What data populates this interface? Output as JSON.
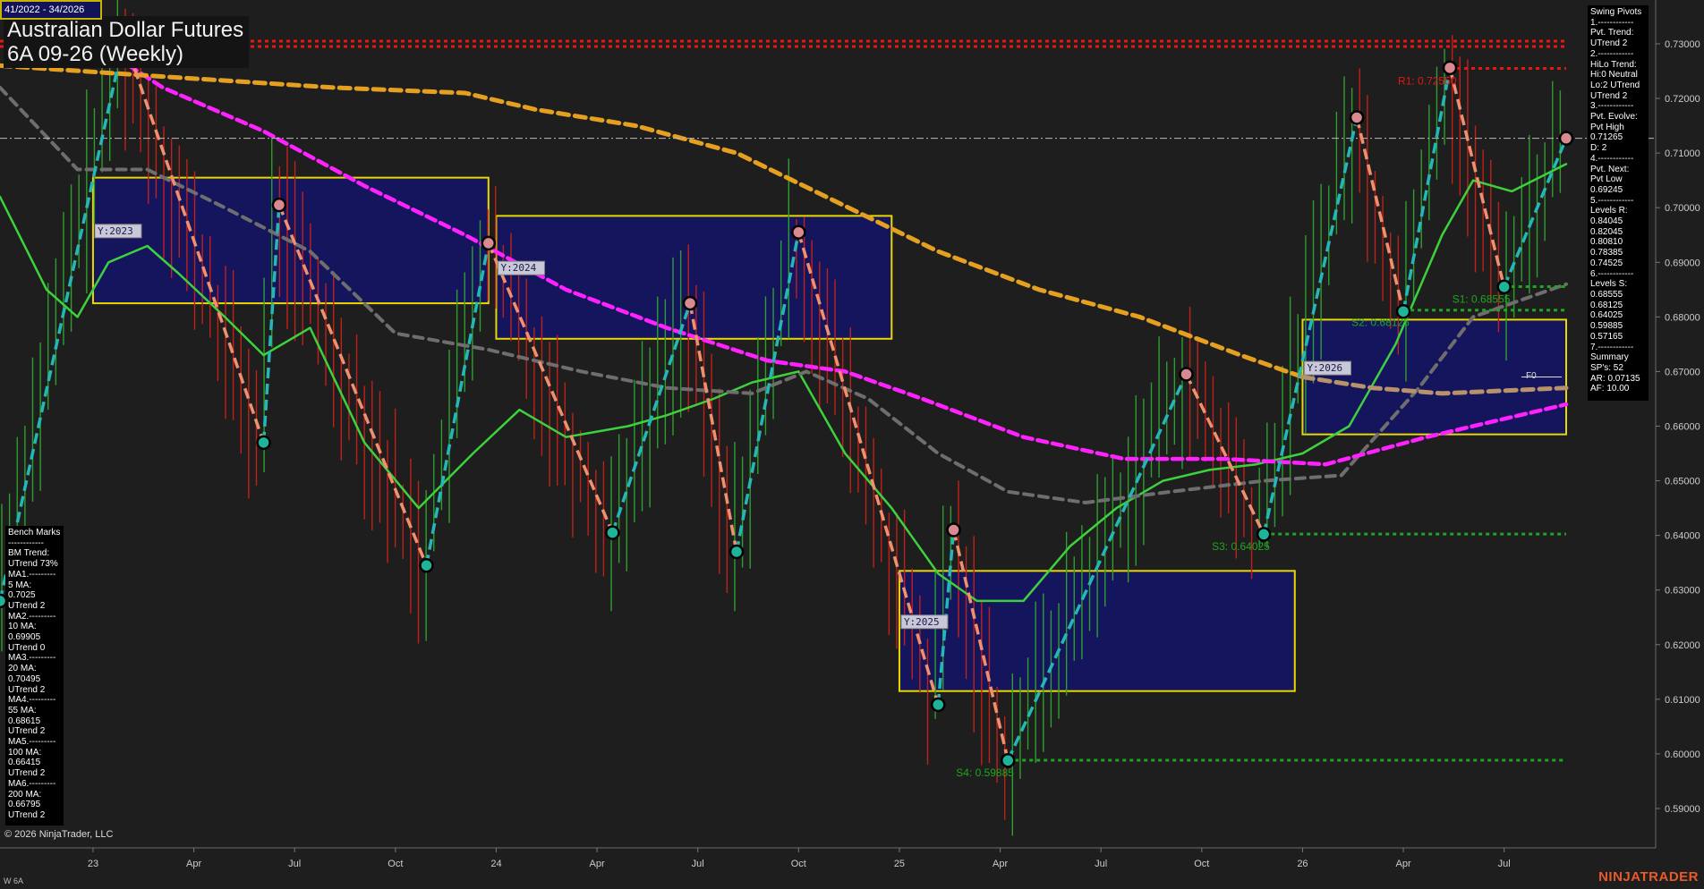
{
  "window": {
    "date_range": "41/2022 - 34/2026",
    "title_line1": "Australian Dollar Futures",
    "title_line2": "6A 09-26 (Weekly)",
    "copyright": "© 2026 NinjaTrader, LLC",
    "symbol_footer": "W 6A",
    "brand": "NINJATRADER"
  },
  "swing_panel": {
    "lines": [
      "Swing Pivots",
      "1.------------",
      "Pvt. Trend:",
      "UTrend 2",
      "2.------------",
      "HiLo Trend:",
      "Hi:0 Neutral",
      "Lo:2 UTrend",
      "UTrend 2",
      "3.------------",
      "Pvt. Evolve:",
      "Pvt High",
      "0.71265",
      "D: 2",
      "4.------------",
      "Pvt. Next:",
      "Pvt Low",
      "0.69245",
      "5.------------",
      "Levels R:",
      "0.84045",
      "0.82045",
      "0.80810",
      "0.78385",
      "0.74525",
      "6.------------",
      "Levels S:",
      "0.68555",
      "0.68125",
      "0.64025",
      "0.59885",
      "0.57165",
      "7.------------",
      "Summary",
      "SP's: 52",
      "AR: 0.07135",
      "AF: 10.00"
    ]
  },
  "bench_panel": {
    "lines": [
      "Bench Marks",
      "------------",
      "BM Trend:",
      "UTrend 73%",
      "MA1.---------",
      "5 MA:",
      "0.7025",
      "UTrend 2",
      "MA2.---------",
      "10 MA:",
      "0.69905",
      "UTrend 0",
      "MA3.---------",
      "20 MA:",
      "0.70495",
      "UTrend 2",
      "MA4.---------",
      "55 MA:",
      "0.68615",
      "UTrend 2",
      "MA5.---------",
      "100 MA:",
      "0.66415",
      "UTrend 2",
      "MA6.---------",
      "200 MA:",
      "0.66795",
      "UTrend 2"
    ]
  },
  "colors": {
    "background": "#1e1e1e",
    "up_bar": "#2e9e2e",
    "down_bar": "#c0201a",
    "ma_green": "#3dd13d",
    "ma_grey": "#6e6e6e",
    "ma_magenta": "#ff22ff",
    "ma_orange": "#e5a020",
    "ma_tan": "#b8926a",
    "up_leg": "#25b7b7",
    "down_leg": "#f0906e",
    "resistance": "#e01818",
    "support": "#1fa51f",
    "box_border": "#e8d800",
    "box_fill": "#15155e"
  },
  "chart_data": {
    "type": "candlestick",
    "y_axis": {
      "ylim": [
        0.585,
        0.735
      ],
      "ticks": [
        "0.73000",
        "0.72000",
        "0.71000",
        "0.70000",
        "0.69000",
        "0.68000",
        "0.67000",
        "0.66000",
        "0.65000",
        "0.64000",
        "0.63000",
        "0.62000",
        "0.61000",
        "0.60000",
        "0.59000"
      ],
      "tick_values": [
        0.73,
        0.72,
        0.71,
        0.7,
        0.69,
        0.68,
        0.67,
        0.66,
        0.65,
        0.64,
        0.63,
        0.62,
        0.61,
        0.6,
        0.59
      ]
    },
    "x_axis": {
      "start": "2022-10-10",
      "end": "2026-08-24",
      "ticks": [
        {
          "label": "23",
          "date": "2023-01-02"
        },
        {
          "label": "Apr",
          "date": "2023-04-03"
        },
        {
          "label": "Jul",
          "date": "2023-07-03"
        },
        {
          "label": "Oct",
          "date": "2023-10-02"
        },
        {
          "label": "24",
          "date": "2024-01-01"
        },
        {
          "label": "Apr",
          "date": "2024-04-01"
        },
        {
          "label": "Jul",
          "date": "2024-07-01"
        },
        {
          "label": "Oct",
          "date": "2024-09-30"
        },
        {
          "label": "25",
          "date": "2024-12-30"
        },
        {
          "label": "Apr",
          "date": "2025-03-31"
        },
        {
          "label": "Jul",
          "date": "2025-06-30"
        },
        {
          "label": "Oct",
          "date": "2025-09-29"
        },
        {
          "label": "26",
          "date": "2025-12-29"
        },
        {
          "label": "Apr",
          "date": "2026-03-30"
        },
        {
          "label": "Jul",
          "date": "2026-06-29"
        }
      ]
    },
    "current_price": 0.7127,
    "price_marker_label": "F0",
    "swing_pivots": [
      {
        "date": "2022-10-10",
        "value": 0.628
      },
      {
        "date": "2023-01-30",
        "value": 0.731
      },
      {
        "date": "2023-06-05",
        "value": 0.657
      },
      {
        "date": "2023-06-19",
        "value": 0.7005
      },
      {
        "date": "2023-10-30",
        "value": 0.6345
      },
      {
        "date": "2023-12-25",
        "value": 0.6935
      },
      {
        "date": "2024-04-15",
        "value": 0.6405
      },
      {
        "date": "2024-06-24",
        "value": 0.6825
      },
      {
        "date": "2024-08-05",
        "value": 0.637
      },
      {
        "date": "2024-09-30",
        "value": 0.6955
      },
      {
        "date": "2025-02-03",
        "value": 0.609
      },
      {
        "date": "2025-02-17",
        "value": 0.641
      },
      {
        "date": "2025-04-07",
        "value": 0.5988
      },
      {
        "date": "2025-09-15",
        "value": 0.6695
      },
      {
        "date": "2025-11-24",
        "value": 0.6402
      },
      {
        "date": "2026-02-16",
        "value": 0.7165
      },
      {
        "date": "2026-03-30",
        "value": 0.681
      },
      {
        "date": "2026-05-11",
        "value": 0.7256
      },
      {
        "date": "2026-06-29",
        "value": 0.6855
      },
      {
        "date": "2026-08-24",
        "value": 0.7127
      }
    ],
    "levels": [
      {
        "label": "R1: 0.72550",
        "value": 0.7255,
        "kind": "resistance",
        "start": "2026-05-11",
        "end": "2026-08-24"
      },
      {
        "label": "",
        "value": 0.7305,
        "kind": "resistance",
        "start": "2022-10-10",
        "end": "2026-08-24"
      },
      {
        "label": "",
        "value": 0.7295,
        "kind": "resistance",
        "start": "2022-10-10",
        "end": "2026-08-24"
      },
      {
        "label": "S1: 0.68555",
        "value": 0.68555,
        "kind": "support",
        "start": "2026-06-29",
        "end": "2026-08-24"
      },
      {
        "label": "S2: 0.68125",
        "value": 0.68125,
        "kind": "support",
        "start": "2026-03-30",
        "end": "2026-08-24"
      },
      {
        "label": "S3: 0.64025",
        "value": 0.64025,
        "kind": "support",
        "start": "2025-11-24",
        "end": "2026-08-24"
      },
      {
        "label": "S4: 0.59885",
        "value": 0.59885,
        "kind": "support",
        "start": "2025-04-07",
        "end": "2026-08-24"
      }
    ],
    "year_boxes": [
      {
        "label": "Y:2023",
        "start": "2023-01-02",
        "end": "2023-12-25",
        "high": 0.7055,
        "low": 0.6825
      },
      {
        "label": "Y:2024",
        "start": "2024-01-01",
        "end": "2024-12-23",
        "high": 0.6985,
        "low": 0.676
      },
      {
        "label": "Y:2025",
        "start": "2024-12-30",
        "end": "2025-12-22",
        "high": 0.6335,
        "low": 0.6115
      },
      {
        "label": "Y:2026",
        "start": "2025-12-29",
        "end": "2026-08-24",
        "high": 0.6795,
        "low": 0.6585
      }
    ],
    "moving_averages": [
      {
        "name": "20 MA",
        "color": "#3dd13d",
        "width": 2.5,
        "dash": "",
        "points": [
          [
            "2022-10-10",
            0.702
          ],
          [
            "2022-11-21",
            0.685
          ],
          [
            "2022-12-19",
            0.68
          ],
          [
            "2023-01-16",
            0.69
          ],
          [
            "2023-02-20",
            0.693
          ],
          [
            "2023-03-20",
            0.688
          ],
          [
            "2023-05-01",
            0.68
          ],
          [
            "2023-06-05",
            0.673
          ],
          [
            "2023-07-17",
            0.678
          ],
          [
            "2023-09-04",
            0.657
          ],
          [
            "2023-10-23",
            0.645
          ],
          [
            "2023-12-11",
            0.655
          ],
          [
            "2024-01-22",
            0.663
          ],
          [
            "2024-03-04",
            0.658
          ],
          [
            "2024-04-29",
            0.66
          ],
          [
            "2024-06-03",
            0.662
          ],
          [
            "2024-07-15",
            0.665
          ],
          [
            "2024-08-19",
            0.668
          ],
          [
            "2024-09-30",
            0.67
          ],
          [
            "2024-11-11",
            0.655
          ],
          [
            "2024-12-23",
            0.645
          ],
          [
            "2025-02-03",
            0.633
          ],
          [
            "2025-03-10",
            0.628
          ],
          [
            "2025-04-21",
            0.628
          ],
          [
            "2025-06-02",
            0.638
          ],
          [
            "2025-07-14",
            0.645
          ],
          [
            "2025-08-25",
            0.65
          ],
          [
            "2025-10-06",
            0.652
          ],
          [
            "2025-11-17",
            0.653
          ],
          [
            "2025-12-29",
            0.655
          ],
          [
            "2026-02-09",
            0.66
          ],
          [
            "2026-03-23",
            0.675
          ],
          [
            "2026-05-04",
            0.695
          ],
          [
            "2026-06-01",
            0.705
          ],
          [
            "2026-07-06",
            0.703
          ],
          [
            "2026-08-24",
            0.708
          ]
        ]
      },
      {
        "name": "55 MA",
        "color": "#6e6e6e",
        "width": 4,
        "dash": "10,7",
        "points": [
          [
            "2022-10-10",
            0.722
          ],
          [
            "2022-12-19",
            0.707
          ],
          [
            "2023-02-20",
            0.707
          ],
          [
            "2023-05-01",
            0.7
          ],
          [
            "2023-07-17",
            0.692
          ],
          [
            "2023-10-02",
            0.677
          ],
          [
            "2023-12-25",
            0.674
          ],
          [
            "2024-03-18",
            0.67
          ],
          [
            "2024-06-03",
            0.667
          ],
          [
            "2024-08-19",
            0.666
          ],
          [
            "2024-10-07",
            0.67
          ],
          [
            "2024-12-02",
            0.665
          ],
          [
            "2025-02-03",
            0.655
          ],
          [
            "2025-04-07",
            0.648
          ],
          [
            "2025-06-16",
            0.646
          ],
          [
            "2025-09-01",
            0.648
          ],
          [
            "2025-11-24",
            0.65
          ],
          [
            "2026-02-02",
            0.651
          ],
          [
            "2026-04-13",
            0.667
          ],
          [
            "2026-06-01",
            0.68
          ],
          [
            "2026-08-24",
            0.686
          ]
        ]
      },
      {
        "name": "100 MA",
        "color": "#ff22ff",
        "width": 4.5,
        "dash": "11,6",
        "points": [
          [
            "2022-10-10",
            0.741
          ],
          [
            "2022-12-05",
            0.734
          ],
          [
            "2023-03-06",
            0.722
          ],
          [
            "2023-06-05",
            0.714
          ],
          [
            "2023-09-04",
            0.704
          ],
          [
            "2023-12-04",
            0.695
          ],
          [
            "2024-03-04",
            0.685
          ],
          [
            "2024-06-03",
            0.678
          ],
          [
            "2024-09-02",
            0.672
          ],
          [
            "2024-11-11",
            0.67
          ],
          [
            "2025-01-20",
            0.665
          ],
          [
            "2025-04-21",
            0.658
          ],
          [
            "2025-07-21",
            0.654
          ],
          [
            "2025-10-20",
            0.654
          ],
          [
            "2026-01-19",
            0.653
          ],
          [
            "2026-04-20",
            0.658
          ],
          [
            "2026-08-24",
            0.664
          ]
        ]
      },
      {
        "name": "200 MA",
        "color": "#e5a020",
        "width": 5,
        "dash": "12,7",
        "points": [
          [
            "2022-10-10",
            0.726
          ],
          [
            "2023-03-06",
            0.724
          ],
          [
            "2023-08-07",
            0.722
          ],
          [
            "2023-12-04",
            0.721
          ],
          [
            "2024-02-05",
            0.718
          ],
          [
            "2024-05-06",
            0.715
          ],
          [
            "2024-08-05",
            0.71
          ],
          [
            "2024-11-04",
            0.701
          ],
          [
            "2025-02-03",
            0.692
          ],
          [
            "2025-05-05",
            0.685
          ],
          [
            "2025-08-04",
            0.68
          ],
          [
            "2025-11-03",
            0.673
          ],
          [
            "2025-12-29",
            0.669
          ]
        ]
      },
      {
        "name": "200 MA tail",
        "color": "#b8926a",
        "width": 5,
        "dash": "12,7",
        "points": [
          [
            "2025-12-29",
            0.669
          ],
          [
            "2026-03-02",
            0.667
          ],
          [
            "2026-05-04",
            0.666
          ],
          [
            "2026-08-24",
            0.667
          ]
        ]
      }
    ]
  }
}
